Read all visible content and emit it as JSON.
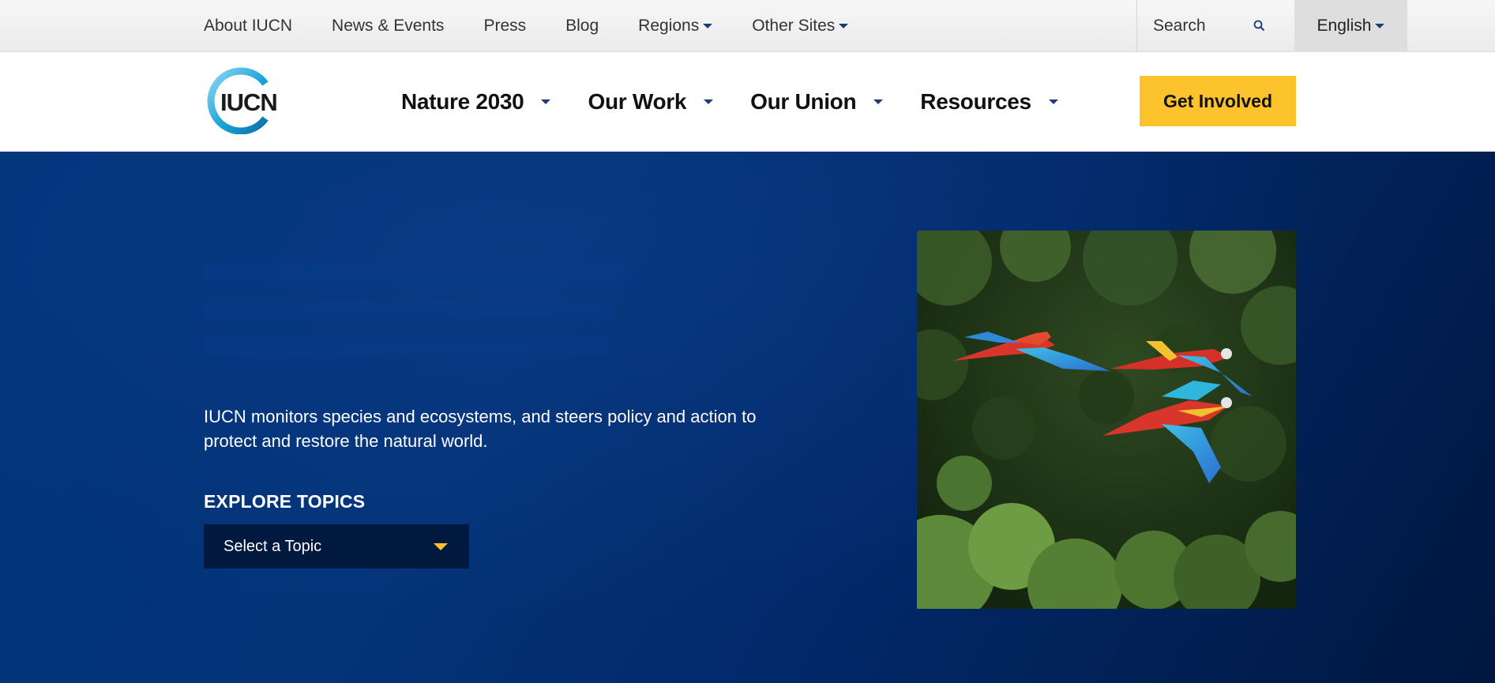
{
  "utility_nav": {
    "links": [
      {
        "label": "About IUCN",
        "has_dropdown": false
      },
      {
        "label": "News & Events",
        "has_dropdown": false
      },
      {
        "label": "Press",
        "has_dropdown": false
      },
      {
        "label": "Blog",
        "has_dropdown": false
      },
      {
        "label": "Regions",
        "has_dropdown": true
      },
      {
        "label": "Other Sites",
        "has_dropdown": true
      }
    ],
    "search_placeholder": "Search",
    "search_icon": "search-icon",
    "language": "English"
  },
  "main_nav": {
    "logo_text": "IUCN",
    "items": [
      {
        "label": "Nature 2030"
      },
      {
        "label": "Our Work"
      },
      {
        "label": "Our Union"
      },
      {
        "label": "Resources"
      }
    ],
    "cta_label": "Get Involved"
  },
  "hero": {
    "description": "IUCN monitors species and ecosystems, and steers policy and action to protect and restore the natural world.",
    "explore_label": "EXPLORE TOPICS",
    "topic_select": "Select a Topic",
    "image_alt": "scarlet macaws in flight over rainforest"
  },
  "colors": {
    "hero_blue": "#043378",
    "cta_yellow": "#fdc32d",
    "select_bg": "#01193f",
    "caret_blue": "#1c3b78",
    "logo_teal": "#1aa3d9"
  }
}
